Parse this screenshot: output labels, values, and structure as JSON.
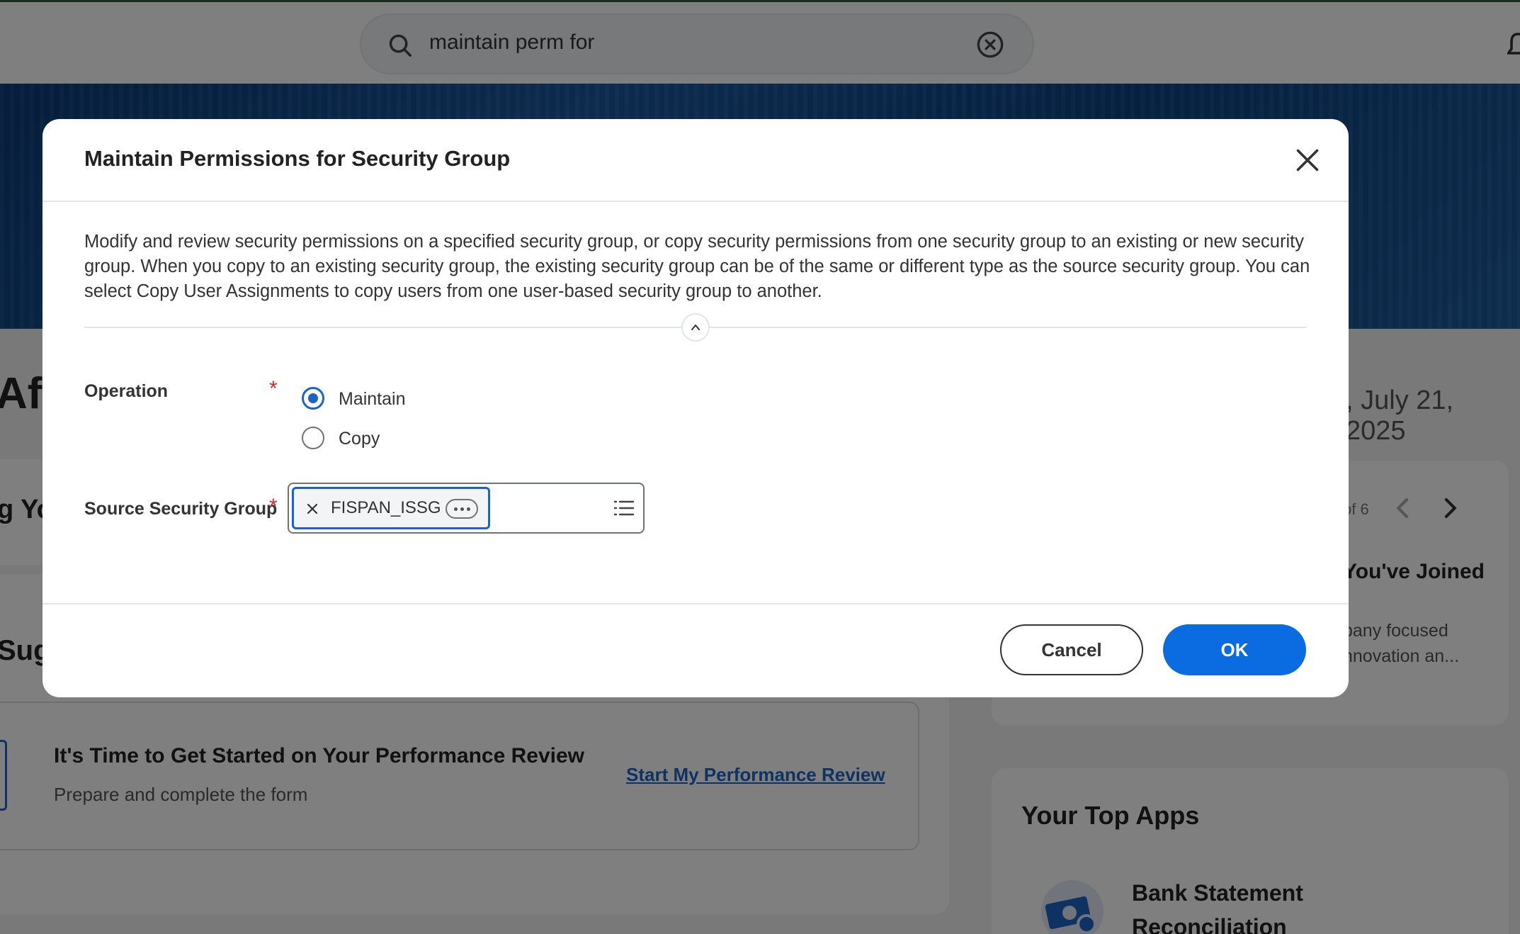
{
  "search": {
    "query": "maintain perm for"
  },
  "background": {
    "greeting_fragment": "Aft",
    "date_fragment": ", July 21, 2025",
    "section_fragment_1": "g Yo",
    "section_fragment_2": "Sug",
    "review": {
      "title": "It's Time to Get Started on Your Performance Review",
      "subtitle": "Prepare and complete the form",
      "link": "Start My Performance Review"
    },
    "carousel": {
      "pager": "of 6",
      "card_title": "You've Joined",
      "card_line_1": "pany focused",
      "card_line_2": "nnovation an..."
    },
    "top_apps": {
      "title": "Your Top Apps",
      "app_line_1": "Bank Statement",
      "app_line_2": "Reconciliation"
    }
  },
  "modal": {
    "title": "Maintain Permissions for Security Group",
    "description_lines": [
      "Modify and review security permissions on a specified security group, or copy security permissions from one security group to an existing or new security",
      "group. When you copy to an existing security group, the existing security group can be of the same or different type as the source security group. You can",
      "select Copy User Assignments to copy users from one user-based security group to another."
    ],
    "operation": {
      "label": "Operation",
      "required_mark": "*",
      "options": [
        "Maintain",
        "Copy"
      ],
      "selected": "Maintain"
    },
    "source_security_group": {
      "label": "Source Security Group",
      "required_mark": "*",
      "selected_value": "FISPAN_ISSG"
    },
    "buttons": {
      "cancel": "Cancel",
      "ok": "OK"
    }
  },
  "colors": {
    "primary": "#0b6be0",
    "radio_selected": "#1c64c4",
    "required": "#d02c2c",
    "overlay": "rgba(0,0,0,0.5)"
  }
}
